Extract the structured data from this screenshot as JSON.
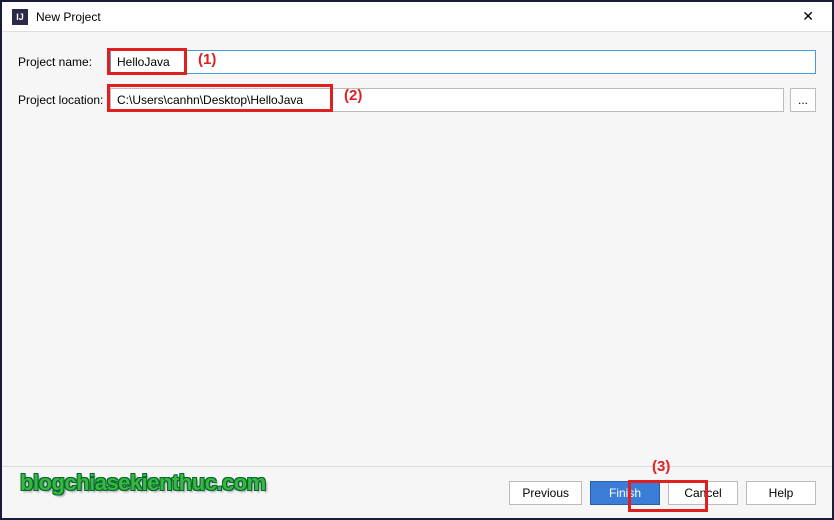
{
  "window": {
    "title": "New Project",
    "app_icon_label": "IJ"
  },
  "form": {
    "name_label": "Project name:",
    "name_value": "HelloJava",
    "location_label": "Project location:",
    "location_value": "C:\\Users\\canhn\\Desktop\\HelloJava",
    "browse_label": "..."
  },
  "annotations": {
    "a1": "(1)",
    "a2": "(2)",
    "a3": "(3)"
  },
  "buttons": {
    "previous": "Previous",
    "finish": "Finish",
    "cancel": "Cancel",
    "help": "Help"
  },
  "watermark": "blogchiasekienthuc.com"
}
